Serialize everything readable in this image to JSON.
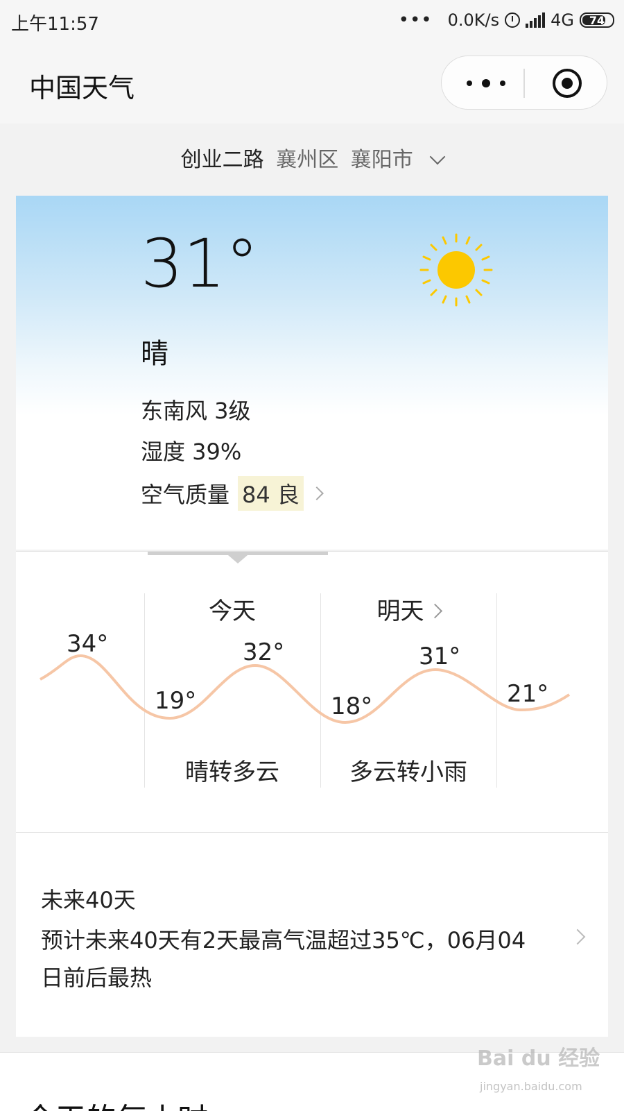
{
  "status_bar": {
    "time": "上午11:57",
    "dots": "•••",
    "net_speed": "0.0K/s",
    "network": "4G",
    "battery": "74"
  },
  "nav": {
    "title": "中国天气"
  },
  "location": {
    "street": "创业二路",
    "district": "襄州区",
    "city": "襄阳市"
  },
  "current": {
    "temp": "31°",
    "condition": "晴",
    "wind": "东南风 3级",
    "humidity": "湿度 39%",
    "aqi_label": "空气质量",
    "aqi_value": "84 良",
    "colors": {
      "sun": "#fcc800",
      "aqi_bg": "#f7f3d6",
      "sky": "#a9d7f5"
    }
  },
  "forecast": {
    "days": [
      {
        "label": "今天",
        "condition": "晴转多云"
      },
      {
        "label": "明天",
        "condition": "多云转小雨"
      }
    ],
    "temps": {
      "prev_high": "34°",
      "today_low": "19°",
      "today_high": "32°",
      "tomorrow_low": "18°",
      "tomorrow_high": "31°",
      "next_low": "21°"
    },
    "curve_color": "#f6c6a6"
  },
  "longterm": {
    "title": "未来40天",
    "description": "预计未来40天有2天最高气温超过35℃，06月04日前后最热"
  },
  "hourly": {
    "title": "今天的每小时"
  },
  "watermark": {
    "brand": "Bai du 经验",
    "url": "jingyan.baidu.com"
  }
}
